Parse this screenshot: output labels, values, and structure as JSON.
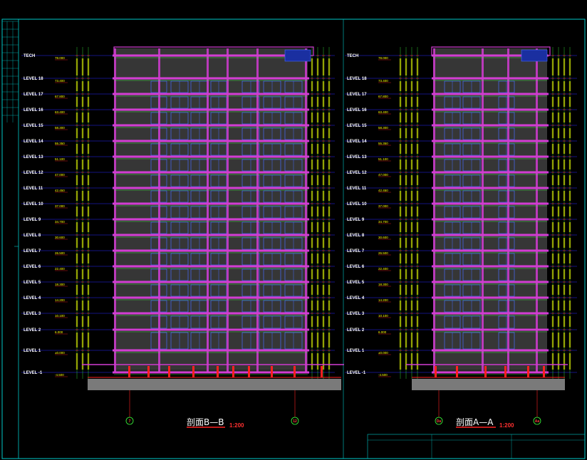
{
  "drawing": {
    "background": "#000000",
    "colors": {
      "frame": "#00c8c8",
      "level_line": "#2b2bff",
      "slab": "#d23cd2",
      "wall": "#8a8a8a",
      "window": "#4a6cff",
      "green": "#3cff3c",
      "yellow": "#ffff00",
      "red": "#ff2020",
      "white": "#ffffff"
    },
    "levels": [
      {
        "label": "TECH",
        "elev": "78.000"
      },
      {
        "label": "LEVEL 18",
        "elev": "73.400"
      },
      {
        "label": "LEVEL 17",
        "elev": "67.800"
      },
      {
        "label": "LEVEL 16",
        "elev": "63.400"
      },
      {
        "label": "LEVEL 15",
        "elev": "58.300"
      },
      {
        "label": "LEVEL 14",
        "elev": "55.350"
      },
      {
        "label": "LEVEL 13",
        "elev": "51.100"
      },
      {
        "label": "LEVEL 12",
        "elev": "47.000"
      },
      {
        "label": "LEVEL 11",
        "elev": "42.450"
      },
      {
        "label": "LEVEL 10",
        "elev": "37.000"
      },
      {
        "label": "LEVEL 9",
        "elev": "34.700"
      },
      {
        "label": "LEVEL 8",
        "elev": "30.600"
      },
      {
        "label": "LEVEL 7",
        "elev": "26.500"
      },
      {
        "label": "LEVEL 6",
        "elev": "22.400"
      },
      {
        "label": "LEVEL 5",
        "elev": "18.300"
      },
      {
        "label": "LEVEL 4",
        "elev": "14.200"
      },
      {
        "label": "LEVEL 3",
        "elev": "10.100"
      },
      {
        "label": "LEVEL 2",
        "elev": "6.000"
      },
      {
        "label": "LEVEL 1",
        "elev": "±0.000"
      },
      {
        "label": "LEVEL -1",
        "elev": "-4.500"
      }
    ],
    "sections": [
      {
        "title": "剖面B—B",
        "scale": "1:200",
        "axes": [
          "7",
          "12"
        ]
      },
      {
        "title": "剖面A—A",
        "scale": "1:200",
        "axes": [
          "Da",
          "Aa"
        ]
      }
    ]
  }
}
